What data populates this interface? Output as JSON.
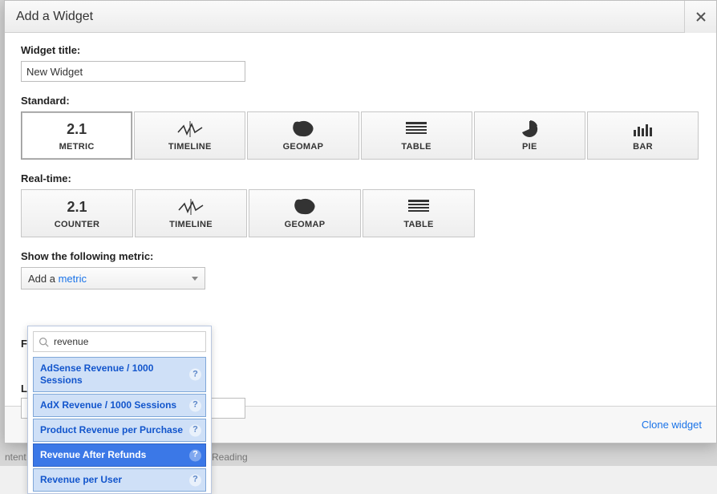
{
  "modal": {
    "title": "Add a Widget"
  },
  "widget_title": {
    "label": "Widget title:",
    "value": "New Widget"
  },
  "sections": {
    "standard_label": "Standard:",
    "realtime_label": "Real-time:",
    "show_metric_label": "Show the following metric:"
  },
  "standard_types": [
    {
      "id": "metric",
      "label": "METRIC",
      "icon": "num",
      "selected": true
    },
    {
      "id": "timeline",
      "label": "TIMELINE",
      "icon": "timeline"
    },
    {
      "id": "geomap",
      "label": "GEOMAP",
      "icon": "geomap"
    },
    {
      "id": "table",
      "label": "TABLE",
      "icon": "table"
    },
    {
      "id": "pie",
      "label": "PIE",
      "icon": "pie"
    },
    {
      "id": "bar",
      "label": "BAR",
      "icon": "bar"
    }
  ],
  "realtime_types": [
    {
      "id": "counter",
      "label": "COUNTER",
      "icon": "num"
    },
    {
      "id": "timeline",
      "label": "TIMELINE",
      "icon": "timeline"
    },
    {
      "id": "geomap",
      "label": "GEOMAP",
      "icon": "geomap"
    },
    {
      "id": "table",
      "label": "TABLE",
      "icon": "table"
    }
  ],
  "metric_dropdown": {
    "prefix": "Add a ",
    "link_text": "metric"
  },
  "metric_search": {
    "value": "revenue"
  },
  "metric_options": [
    {
      "label": "AdSense Revenue / 1000 Sessions",
      "highlight": false
    },
    {
      "label": "AdX Revenue / 1000 Sessions",
      "highlight": false
    },
    {
      "label": "Product Revenue per Purchase",
      "highlight": false
    },
    {
      "label": "Revenue After Refunds",
      "highlight": true
    },
    {
      "label": "Revenue per User",
      "highlight": false
    }
  ],
  "footer": {
    "clone_label": "Clone widget"
  },
  "truncated_labels": {
    "t1": "F",
    "t2": "L"
  },
  "background_fragments": {
    "f1": "ntent",
    "f2": "Reading"
  },
  "icon_numeric": "2.1"
}
